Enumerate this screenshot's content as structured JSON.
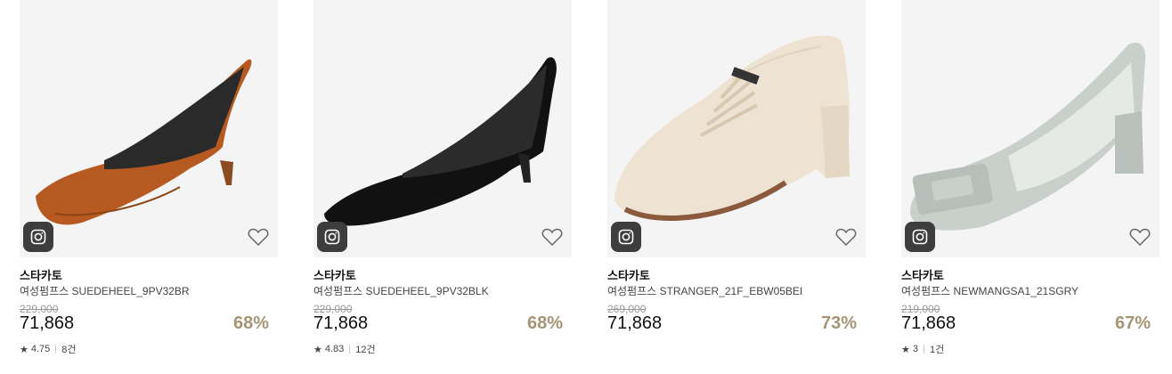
{
  "products": [
    {
      "brand": "스타카토",
      "name": "여성펌프스 SUEDEHEEL_9PV32BR",
      "original_price": "229,000",
      "price": "71,868",
      "discount": "68%",
      "rating": "4.75",
      "reviews": "8건",
      "shoe_color": "#b65a21",
      "icon": "camera-icon"
    },
    {
      "brand": "스타카토",
      "name": "여성펌프스 SUEDEHEEL_9PV32BLK",
      "original_price": "229,000",
      "price": "71,868",
      "discount": "68%",
      "rating": "4.83",
      "reviews": "12건",
      "shoe_color": "#111111",
      "icon": "camera-icon"
    },
    {
      "brand": "스타카토",
      "name": "여성펌프스 STRANGER_21F_EBW05BEI",
      "original_price": "269,000",
      "price": "71,868",
      "discount": "73%",
      "shoe_color": "#eee3d3",
      "icon": "camera-icon"
    },
    {
      "brand": "스타카토",
      "name": "여성펌프스 NEWMANGSA1_21SGRY",
      "original_price": "219,000",
      "price": "71,868",
      "discount": "67%",
      "rating": "3",
      "reviews": "1건",
      "shoe_color": "#c9cfcb",
      "icon": "camera-icon"
    }
  ],
  "colors": {
    "discount": "#a69575",
    "thumb_bg": "#f4f4f4"
  }
}
